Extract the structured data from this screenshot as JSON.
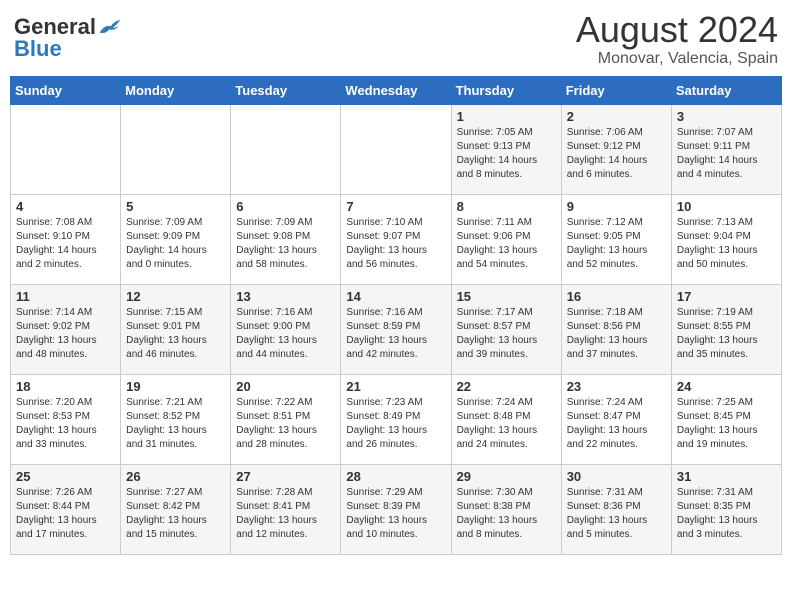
{
  "header": {
    "logo_general": "General",
    "logo_blue": "Blue",
    "month_year": "August 2024",
    "location": "Monovar, Valencia, Spain"
  },
  "days_of_week": [
    "Sunday",
    "Monday",
    "Tuesday",
    "Wednesday",
    "Thursday",
    "Friday",
    "Saturday"
  ],
  "weeks": [
    [
      {
        "day": "",
        "info": ""
      },
      {
        "day": "",
        "info": ""
      },
      {
        "day": "",
        "info": ""
      },
      {
        "day": "",
        "info": ""
      },
      {
        "day": "1",
        "info": "Sunrise: 7:05 AM\nSunset: 9:13 PM\nDaylight: 14 hours\nand 8 minutes."
      },
      {
        "day": "2",
        "info": "Sunrise: 7:06 AM\nSunset: 9:12 PM\nDaylight: 14 hours\nand 6 minutes."
      },
      {
        "day": "3",
        "info": "Sunrise: 7:07 AM\nSunset: 9:11 PM\nDaylight: 14 hours\nand 4 minutes."
      }
    ],
    [
      {
        "day": "4",
        "info": "Sunrise: 7:08 AM\nSunset: 9:10 PM\nDaylight: 14 hours\nand 2 minutes."
      },
      {
        "day": "5",
        "info": "Sunrise: 7:09 AM\nSunset: 9:09 PM\nDaylight: 14 hours\nand 0 minutes."
      },
      {
        "day": "6",
        "info": "Sunrise: 7:09 AM\nSunset: 9:08 PM\nDaylight: 13 hours\nand 58 minutes."
      },
      {
        "day": "7",
        "info": "Sunrise: 7:10 AM\nSunset: 9:07 PM\nDaylight: 13 hours\nand 56 minutes."
      },
      {
        "day": "8",
        "info": "Sunrise: 7:11 AM\nSunset: 9:06 PM\nDaylight: 13 hours\nand 54 minutes."
      },
      {
        "day": "9",
        "info": "Sunrise: 7:12 AM\nSunset: 9:05 PM\nDaylight: 13 hours\nand 52 minutes."
      },
      {
        "day": "10",
        "info": "Sunrise: 7:13 AM\nSunset: 9:04 PM\nDaylight: 13 hours\nand 50 minutes."
      }
    ],
    [
      {
        "day": "11",
        "info": "Sunrise: 7:14 AM\nSunset: 9:02 PM\nDaylight: 13 hours\nand 48 minutes."
      },
      {
        "day": "12",
        "info": "Sunrise: 7:15 AM\nSunset: 9:01 PM\nDaylight: 13 hours\nand 46 minutes."
      },
      {
        "day": "13",
        "info": "Sunrise: 7:16 AM\nSunset: 9:00 PM\nDaylight: 13 hours\nand 44 minutes."
      },
      {
        "day": "14",
        "info": "Sunrise: 7:16 AM\nSunset: 8:59 PM\nDaylight: 13 hours\nand 42 minutes."
      },
      {
        "day": "15",
        "info": "Sunrise: 7:17 AM\nSunset: 8:57 PM\nDaylight: 13 hours\nand 39 minutes."
      },
      {
        "day": "16",
        "info": "Sunrise: 7:18 AM\nSunset: 8:56 PM\nDaylight: 13 hours\nand 37 minutes."
      },
      {
        "day": "17",
        "info": "Sunrise: 7:19 AM\nSunset: 8:55 PM\nDaylight: 13 hours\nand 35 minutes."
      }
    ],
    [
      {
        "day": "18",
        "info": "Sunrise: 7:20 AM\nSunset: 8:53 PM\nDaylight: 13 hours\nand 33 minutes."
      },
      {
        "day": "19",
        "info": "Sunrise: 7:21 AM\nSunset: 8:52 PM\nDaylight: 13 hours\nand 31 minutes."
      },
      {
        "day": "20",
        "info": "Sunrise: 7:22 AM\nSunset: 8:51 PM\nDaylight: 13 hours\nand 28 minutes."
      },
      {
        "day": "21",
        "info": "Sunrise: 7:23 AM\nSunset: 8:49 PM\nDaylight: 13 hours\nand 26 minutes."
      },
      {
        "day": "22",
        "info": "Sunrise: 7:24 AM\nSunset: 8:48 PM\nDaylight: 13 hours\nand 24 minutes."
      },
      {
        "day": "23",
        "info": "Sunrise: 7:24 AM\nSunset: 8:47 PM\nDaylight: 13 hours\nand 22 minutes."
      },
      {
        "day": "24",
        "info": "Sunrise: 7:25 AM\nSunset: 8:45 PM\nDaylight: 13 hours\nand 19 minutes."
      }
    ],
    [
      {
        "day": "25",
        "info": "Sunrise: 7:26 AM\nSunset: 8:44 PM\nDaylight: 13 hours\nand 17 minutes."
      },
      {
        "day": "26",
        "info": "Sunrise: 7:27 AM\nSunset: 8:42 PM\nDaylight: 13 hours\nand 15 minutes."
      },
      {
        "day": "27",
        "info": "Sunrise: 7:28 AM\nSunset: 8:41 PM\nDaylight: 13 hours\nand 12 minutes."
      },
      {
        "day": "28",
        "info": "Sunrise: 7:29 AM\nSunset: 8:39 PM\nDaylight: 13 hours\nand 10 minutes."
      },
      {
        "day": "29",
        "info": "Sunrise: 7:30 AM\nSunset: 8:38 PM\nDaylight: 13 hours\nand 8 minutes."
      },
      {
        "day": "30",
        "info": "Sunrise: 7:31 AM\nSunset: 8:36 PM\nDaylight: 13 hours\nand 5 minutes."
      },
      {
        "day": "31",
        "info": "Sunrise: 7:31 AM\nSunset: 8:35 PM\nDaylight: 13 hours\nand 3 minutes."
      }
    ]
  ]
}
